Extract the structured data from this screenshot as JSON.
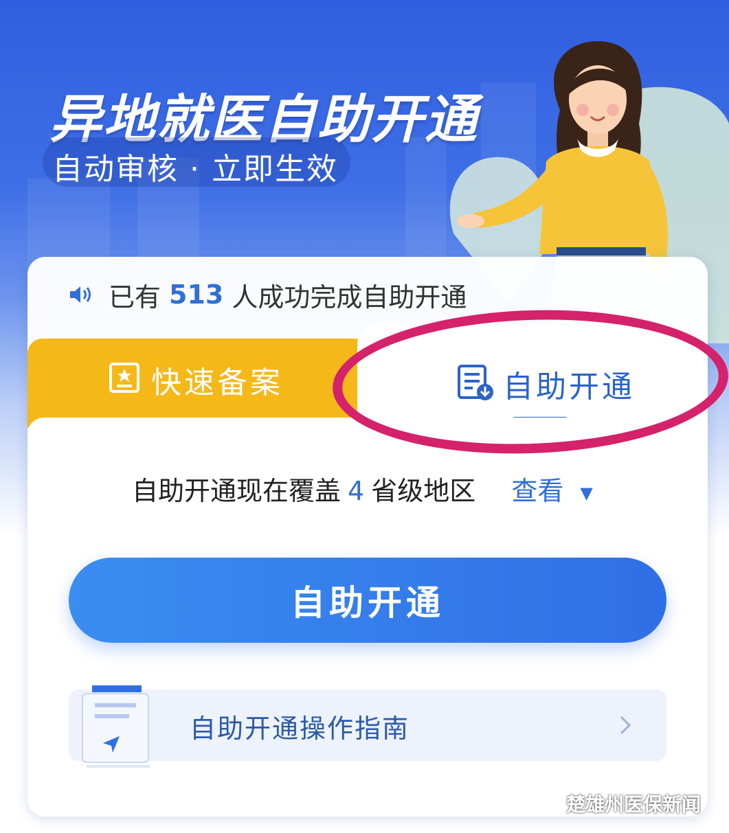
{
  "banner": {
    "title": "异地就医自助开通",
    "subtitle": "自动审核 · 立即生效"
  },
  "notice": {
    "prefix": "已有",
    "count": "513",
    "suffix": "人成功完成自助开通"
  },
  "tabs": [
    {
      "label": "快速备案",
      "icon": "filing-card-icon",
      "active": false
    },
    {
      "label": "自助开通",
      "icon": "document-download-icon",
      "active": true
    }
  ],
  "coverage": {
    "prefix": "自助开通现在覆盖",
    "count": "4",
    "suffix": "省级地区",
    "view_label": "查看",
    "view_icon": "caret-down-icon"
  },
  "main_button": {
    "label": "自助开通"
  },
  "guide": {
    "label": "自助开通操作指南",
    "icon": "chevron-right-icon"
  },
  "watermark": {
    "text": "楚雄州医保新闻"
  },
  "colors": {
    "primary": "#2f6fe6",
    "accent_yellow": "#f5b819",
    "highlight": "#d4226b",
    "text_blue": "#2b63c9"
  }
}
